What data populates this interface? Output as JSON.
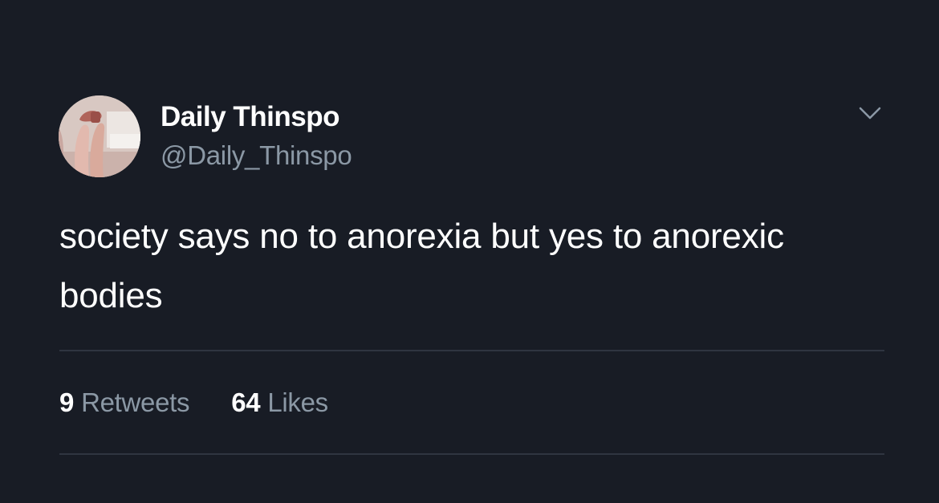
{
  "tweet": {
    "author": {
      "display_name": "Daily Thinspo",
      "handle": "@Daily_Thinspo",
      "avatar_icon": "profile-photo"
    },
    "menu_icon": "chevron-down-icon",
    "text": "society says no to anorexia but yes to anorexic bodies",
    "stats": {
      "retweets_count": "9",
      "retweets_label": "Retweets",
      "likes_count": "64",
      "likes_label": "Likes"
    }
  },
  "colors": {
    "background": "#181c25",
    "primary_text": "#ffffff",
    "secondary_text": "#8b98a5",
    "divider": "#2f3540"
  }
}
